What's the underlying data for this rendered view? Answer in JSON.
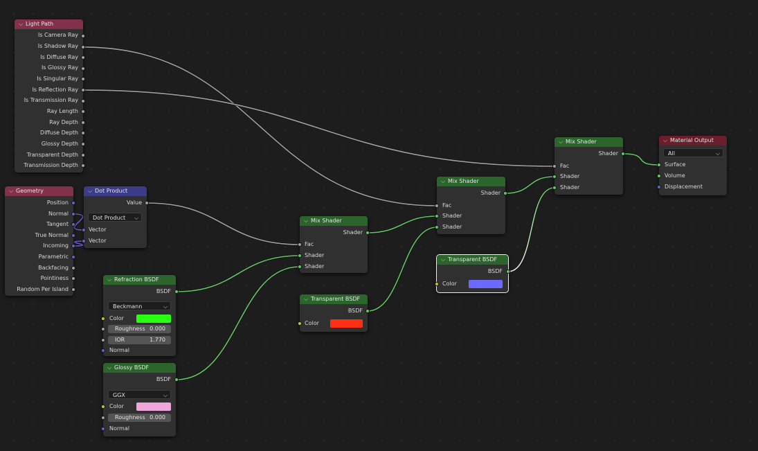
{
  "colors": {
    "input_header": "#83314a",
    "converter_header": "#3b3b88",
    "shader_header": "#2b652b",
    "output_header": "#6a1d2b",
    "socket_float": "#a1a1a1",
    "socket_shader": "#63c763",
    "socket_vector": "#6363c7",
    "socket_color": "#c7c729"
  },
  "light_path": {
    "title": "Light Path",
    "outputs": [
      "Is Camera Ray",
      "Is Shadow Ray",
      "Is Diffuse Ray",
      "Is Glossy Ray",
      "Is Singular Ray",
      "Is Reflection Ray",
      "Is Transmission Ray",
      "Ray Length",
      "Ray Depth",
      "Diffuse Depth",
      "Glossy Depth",
      "Transparent Depth",
      "Transmission Depth"
    ]
  },
  "geometry": {
    "title": "Geometry",
    "outputs": [
      "Position",
      "Normal",
      "Tangent",
      "True Normal",
      "Incoming",
      "Parametric",
      "Backfacing",
      "Pointiness",
      "Random Per Island"
    ]
  },
  "dot_product": {
    "title": "Dot Product",
    "output": "Value",
    "operation": "Dot Product",
    "inputs": [
      "Vector",
      "Vector"
    ]
  },
  "refraction": {
    "title": "Refraction BSDF",
    "output": "BSDF",
    "distribution": "Beckmann",
    "color_label": "Color",
    "color": "#29ff12",
    "roughness_label": "Roughness",
    "roughness": "0.000",
    "ior_label": "IOR",
    "ior": "1.770",
    "normal_label": "Normal"
  },
  "glossy": {
    "title": "Glossy BSDF",
    "output": "BSDF",
    "distribution": "GGX",
    "color_label": "Color",
    "color": "#f0a6dc",
    "roughness_label": "Roughness",
    "roughness": "0.000",
    "normal_label": "Normal"
  },
  "mix1": {
    "title": "Mix Shader",
    "output": "Shader",
    "inputs": [
      "Fac",
      "Shader",
      "Shader"
    ]
  },
  "transparent1": {
    "title": "Transparent BSDF",
    "output": "BSDF",
    "color_label": "Color",
    "color": "#ff3012"
  },
  "mix2": {
    "title": "Mix Shader",
    "output": "Shader",
    "inputs": [
      "Fac",
      "Shader",
      "Shader"
    ]
  },
  "transparent2": {
    "title": "Transparent BSDF",
    "output": "BSDF",
    "color_label": "Color",
    "color": "#6a6aff"
  },
  "mix3": {
    "title": "Mix Shader",
    "output": "Shader",
    "inputs": [
      "Fac",
      "Shader",
      "Shader"
    ]
  },
  "material_output": {
    "title": "Material Output",
    "target": "All",
    "inputs": [
      "Surface",
      "Volume",
      "Displacement"
    ]
  }
}
